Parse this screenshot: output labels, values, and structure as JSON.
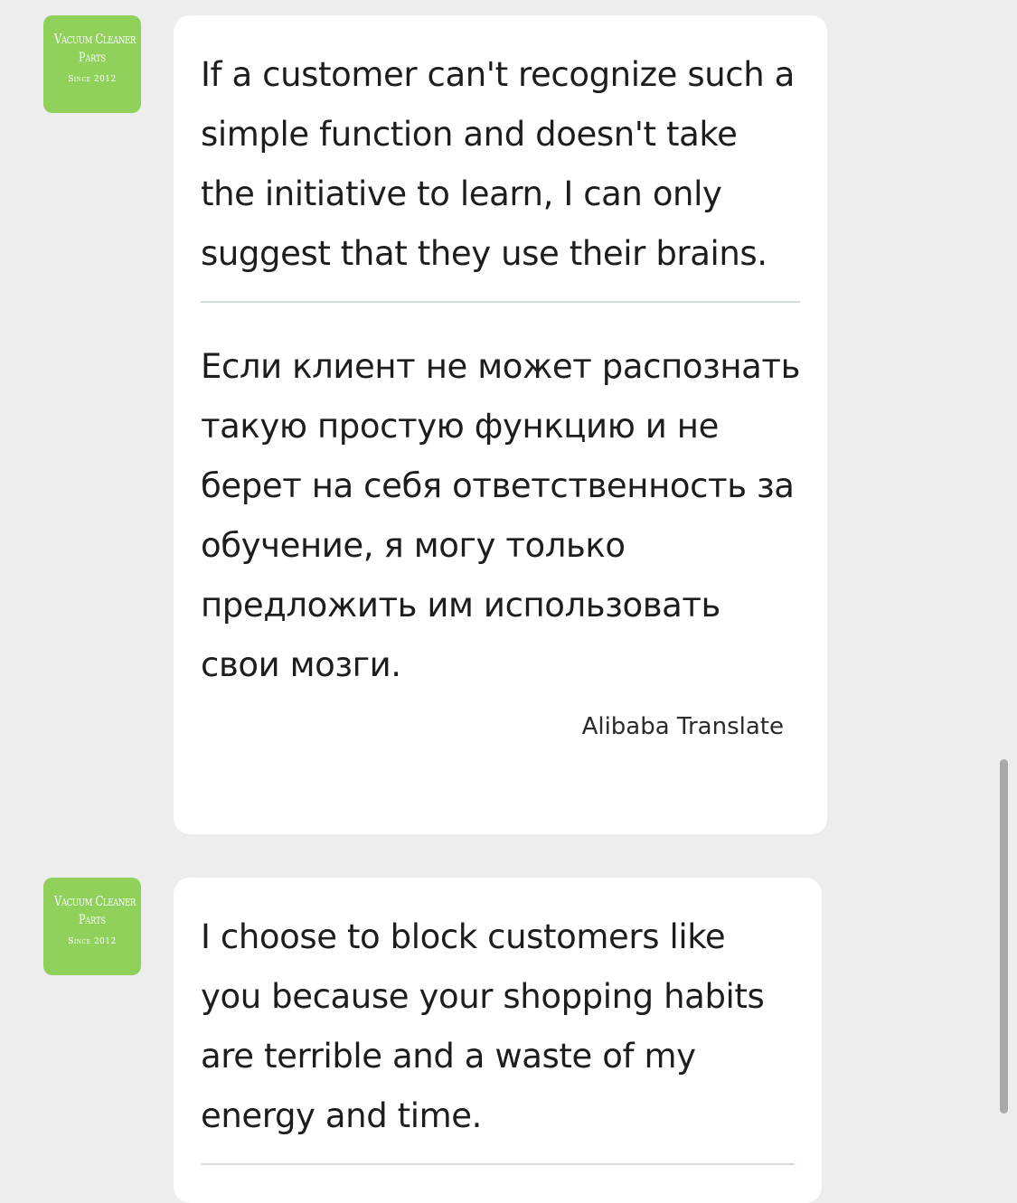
{
  "messages": [
    {
      "avatar": {
        "line1": "Vacuum Cleaner",
        "line2": "Parts",
        "line3": "Since 2012"
      },
      "text": "If a customer can't recognize such a simple function and doesn't take the initiative to learn, I can only suggest that they use their brains.",
      "translation": "Если клиент не может распознать такую простую функцию и не берет на себя ответственность за обучение, я могу только предложить им использовать свои мозги.",
      "translation_source": "Alibaba Translate"
    },
    {
      "avatar": {
        "line1": "Vacuum Cleaner",
        "line2": "Parts",
        "line3": "Since 2012"
      },
      "text": "I choose to block customers like you because your shopping habits are terrible and a waste of my energy and time."
    }
  ],
  "colors": {
    "background": "#ededed",
    "bubble": "#ffffff",
    "avatar": "#8fd15a",
    "divider": "#d3dde0",
    "scrollbar": "#a9a9a9"
  }
}
